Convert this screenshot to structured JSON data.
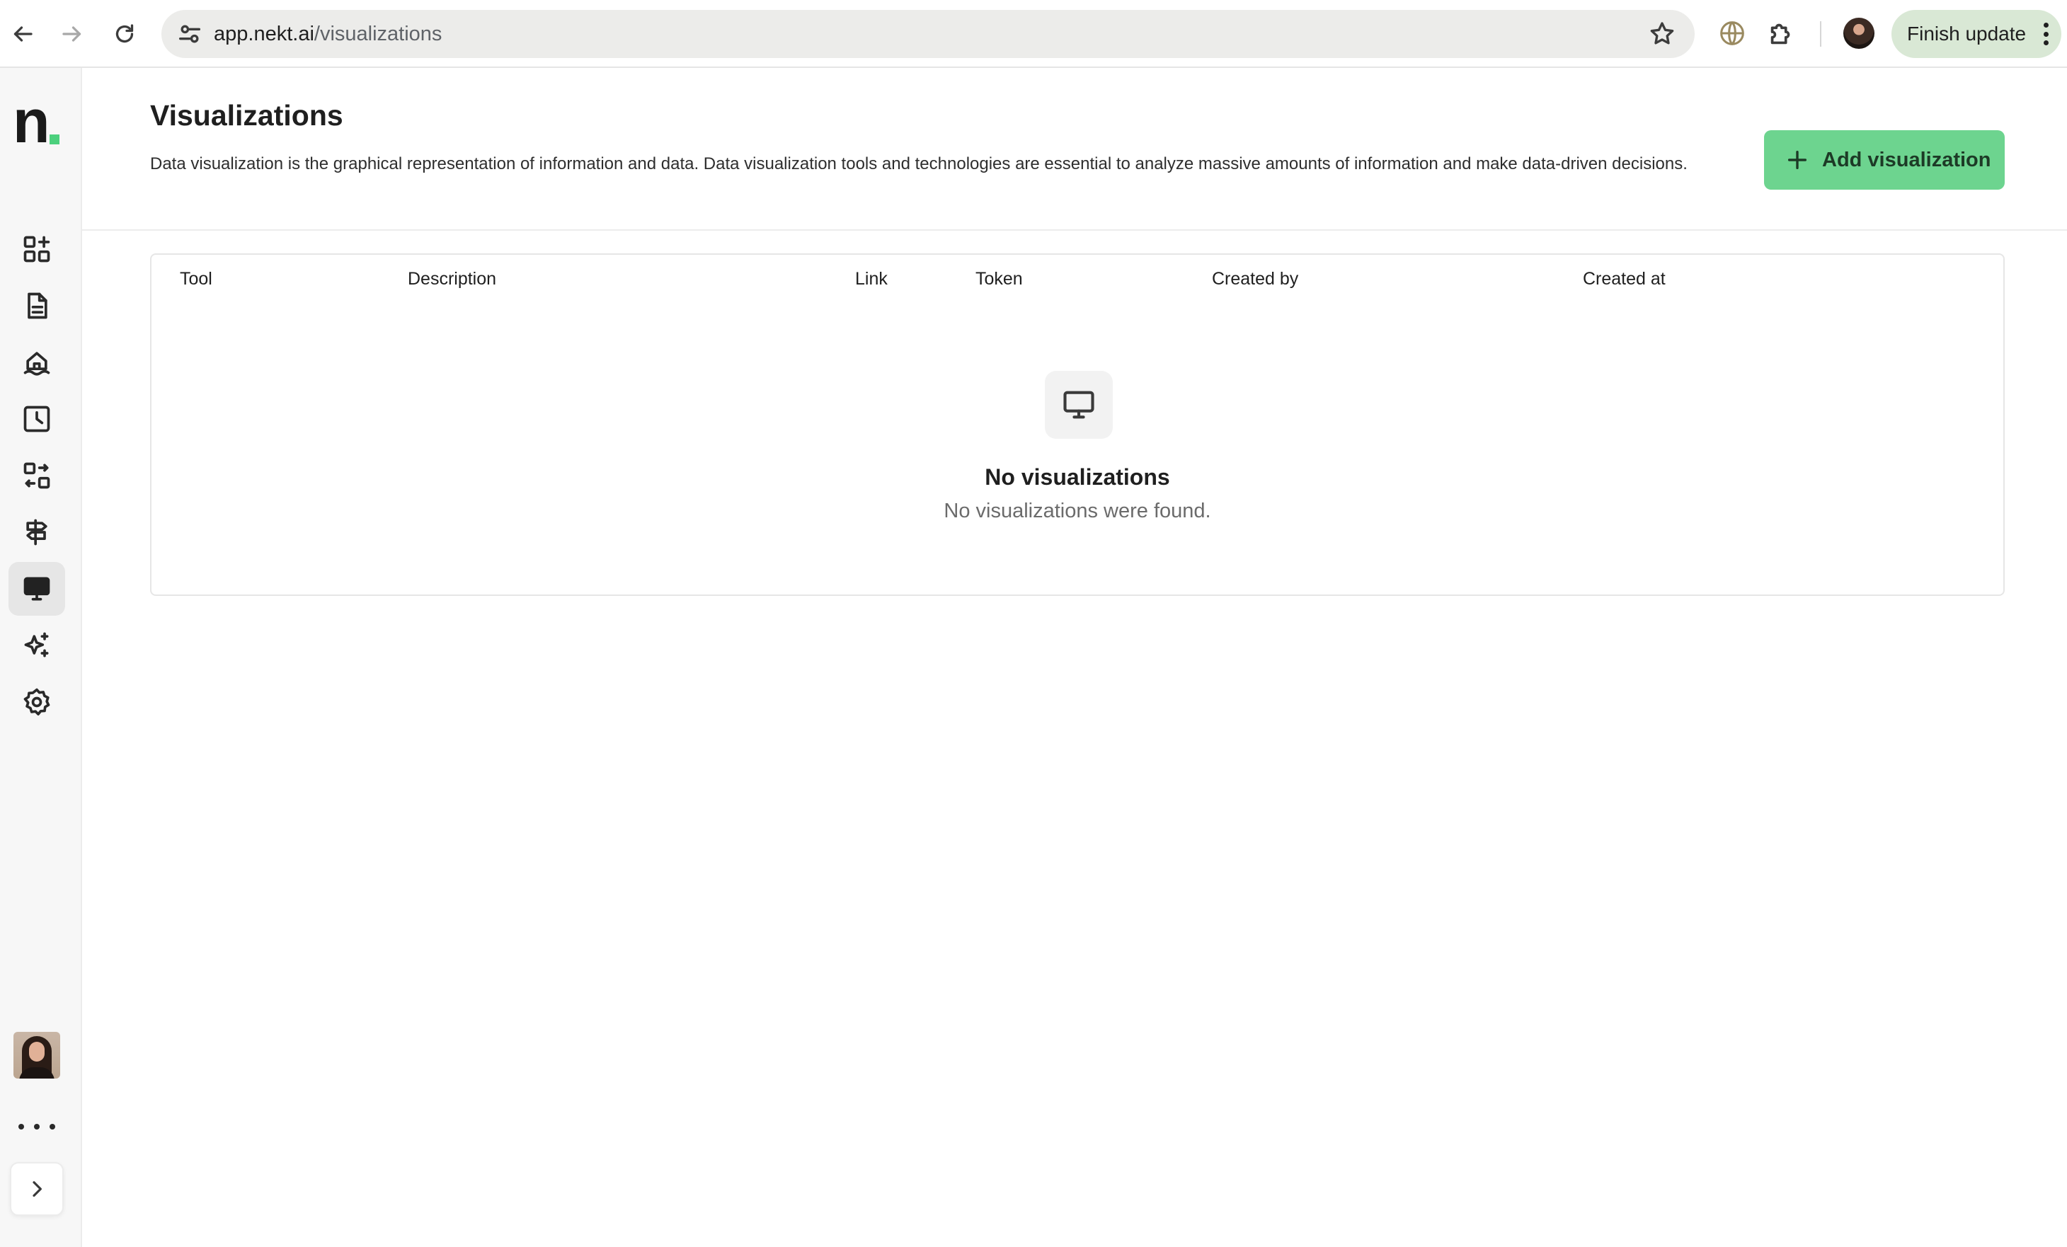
{
  "browser": {
    "url_host": "app.nekt.ai",
    "url_path": "/visualizations",
    "finish_update_label": "Finish update"
  },
  "sidebar": {
    "logo_text": "n",
    "brand_accent_color": "#4cd07d",
    "items": [
      {
        "name": "dashboard-icon"
      },
      {
        "name": "document-icon"
      },
      {
        "name": "lakehouse-icon"
      },
      {
        "name": "history-icon"
      },
      {
        "name": "transform-icon"
      },
      {
        "name": "signpost-icon"
      },
      {
        "name": "monitor-icon",
        "active": true
      },
      {
        "name": "sparkles-icon"
      },
      {
        "name": "gear-icon"
      }
    ]
  },
  "main": {
    "title": "Visualizations",
    "description": "Data visualization is the graphical representation of information and data. Data visualization tools and technologies are essential to analyze massive amounts of information and make data-driven decisions.",
    "add_button_label": "Add visualization",
    "add_button_color": "#6dd48f",
    "table": {
      "columns": [
        "Tool",
        "Description",
        "Link",
        "Token",
        "Created by",
        "Created at"
      ],
      "rows": [],
      "empty_title": "No visualizations",
      "empty_subtitle": "No visualizations were found."
    }
  }
}
